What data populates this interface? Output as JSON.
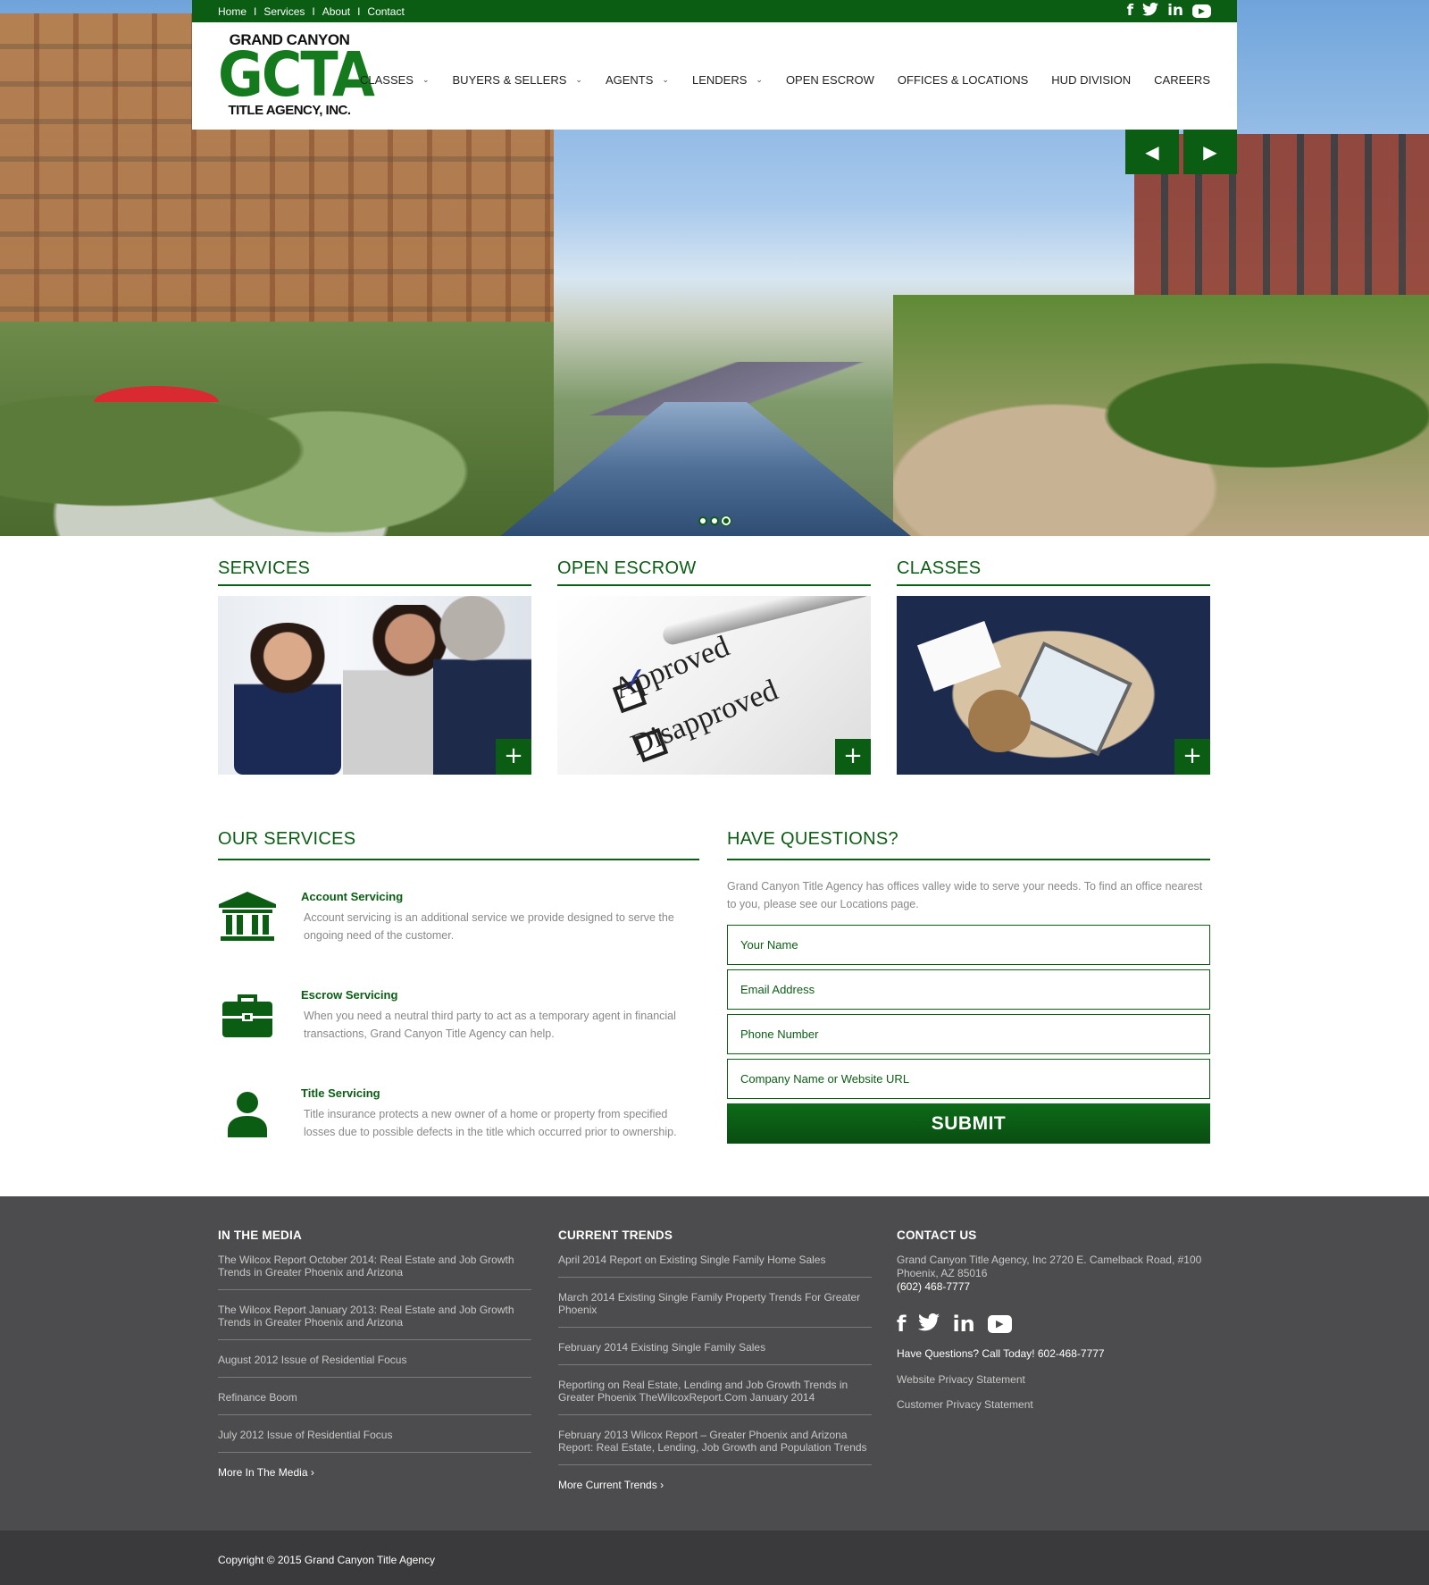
{
  "topbar": {
    "links": [
      "Home",
      "Services",
      "About",
      "Contact"
    ],
    "separator": "I",
    "social": [
      "facebook-icon",
      "twitter-icon",
      "linkedin-icon",
      "youtube-icon"
    ]
  },
  "logo": {
    "line1": "GRAND CANYON",
    "line2": "GCTA",
    "line3": "TITLE AGENCY, INC."
  },
  "nav": {
    "items": [
      {
        "label": "CLASSES",
        "dropdown": true
      },
      {
        "label": "BUYERS & SELLERS",
        "dropdown": true
      },
      {
        "label": "AGENTS",
        "dropdown": true
      },
      {
        "label": "LENDERS",
        "dropdown": true
      },
      {
        "label": "OPEN ESCROW",
        "dropdown": false
      },
      {
        "label": "OFFICES & LOCATIONS",
        "dropdown": false
      },
      {
        "label": "HUD DIVISION",
        "dropdown": false
      },
      {
        "label": "CAREERS",
        "dropdown": false
      }
    ]
  },
  "slider": {
    "prev": "◀",
    "next": "▶",
    "slide_count": 3,
    "active_slide": 3
  },
  "cards": [
    {
      "title": "SERVICES",
      "plus": "+"
    },
    {
      "title": "OPEN ESCROW",
      "plus": "+",
      "image_text": [
        "Approved",
        "Disapproved"
      ]
    },
    {
      "title": "CLASSES",
      "plus": "+"
    }
  ],
  "our_services": {
    "title": "OUR SERVICES",
    "items": [
      {
        "name": "Account Servicing",
        "icon": "bank-icon",
        "desc": "Account servicing is an additional service we provide designed to serve the ongoing need of the customer."
      },
      {
        "name": "Escrow Servicing",
        "icon": "briefcase-icon",
        "desc": "When you need a neutral third party to act as a temporary agent in financial transactions, Grand Canyon Title Agency can help."
      },
      {
        "name": "Title Servicing",
        "icon": "user-icon",
        "desc": "Title insurance protects a new owner of a home or property from specified losses due to possible defects in the title which occurred prior to ownership."
      }
    ]
  },
  "questions": {
    "title": "HAVE QUESTIONS?",
    "intro": "Grand Canyon Title Agency has offices valley wide to serve your needs. To find an office nearest to you, please see our Locations page.",
    "fields": [
      "Your Name",
      "Email Address",
      "Phone Number",
      "Company Name or Website URL"
    ],
    "submit": "SUBMIT"
  },
  "footer": {
    "media": {
      "title": "IN THE MEDIA",
      "links": [
        "The Wilcox Report October 2014: Real Estate and Job Growth Trends in Greater Phoenix and Arizona",
        "The Wilcox Report January 2013: Real Estate and Job Growth Trends in Greater Phoenix and Arizona",
        "August 2012 Issue of Residential Focus",
        "Refinance Boom",
        "July 2012 Issue of Residential Focus"
      ],
      "more": "More In The Media",
      "more_chevron": "›"
    },
    "trends": {
      "title": "CURRENT TRENDS",
      "links": [
        "April 2014 Report on Existing Single Family Home Sales",
        "March 2014 Existing Single Family Property Trends For Greater Phoenix",
        "February 2014 Existing Single Family Sales",
        "Reporting on Real Estate, Lending and Job Growth Trends in Greater Phoenix TheWilcoxReport.Com January 2014",
        "February 2013 Wilcox Report – Greater Phoenix and Arizona Report: Real Estate, Lending, Job Growth and Population Trends"
      ],
      "more": "More Current Trends",
      "more_chevron": "›"
    },
    "contact": {
      "title": "CONTACT US",
      "address": "Grand Canyon Title Agency, Inc 2720 E. Camelback Road, #100 Phoenix, AZ 85016",
      "phone": "(602) 468-7777",
      "call": "Have Questions? Call Today! 602-468-7777",
      "privacy1": "Website Privacy Statement",
      "privacy2": "Customer Privacy Statement"
    },
    "copyright": "Copyright © 2015 Grand Canyon Title Agency"
  },
  "colors": {
    "brand_green": "#0b5d14",
    "footer_bg": "#4c4c4e",
    "copy_bg": "#3a3a3c"
  }
}
